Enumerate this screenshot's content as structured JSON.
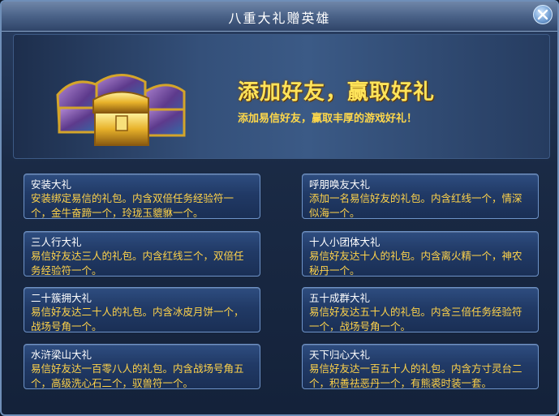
{
  "dialog": {
    "title": "八重大礼赠英雄",
    "close_icon": "close-icon"
  },
  "banner": {
    "headline": "添加好友，赢取好礼",
    "subline": "添加易信好友，赢取丰厚的游戏好礼！",
    "image": "treasure-chests-icon"
  },
  "gifts": [
    {
      "title": "安装大礼",
      "desc": "安装绑定易信的礼包。内含双倍任务经验符一个，金牛奋蹄一个，玲珑玉貔貅一个。"
    },
    {
      "title": "呼朋唤友大礼",
      "desc": "添加一名易信好友的礼包。内含红线一个，情深似海一个。"
    },
    {
      "title": "三人行大礼",
      "desc": "易信好友达三人的礼包。内含红线三个，双倍任务经验符一个。"
    },
    {
      "title": "十人小团体大礼",
      "desc": "易信好友达十人的礼包。内含离火精一个，神农秘丹一个。"
    },
    {
      "title": "二十簇拥大礼",
      "desc": "易信好友达二十人的礼包。内含冰皮月饼一个，战场号角一个。"
    },
    {
      "title": "五十成群大礼",
      "desc": "易信好友达五十人的礼包。内含三倍任务经验符一个，战场号角一个。"
    },
    {
      "title": "水浒梁山大礼",
      "desc": "易信好友达一百零八人的礼包。内含战场号角五个，高级洗心石二个，驭兽符一个。"
    },
    {
      "title": "天下归心大礼",
      "desc": "易信好友达一百五十人的礼包。内含方寸灵台二个，积善祛恶丹一个，有熊裘时装一套。"
    }
  ],
  "colors": {
    "card_title": "#ffffff",
    "card_desc": "#ffd34a",
    "headline": "#ffe45a"
  }
}
